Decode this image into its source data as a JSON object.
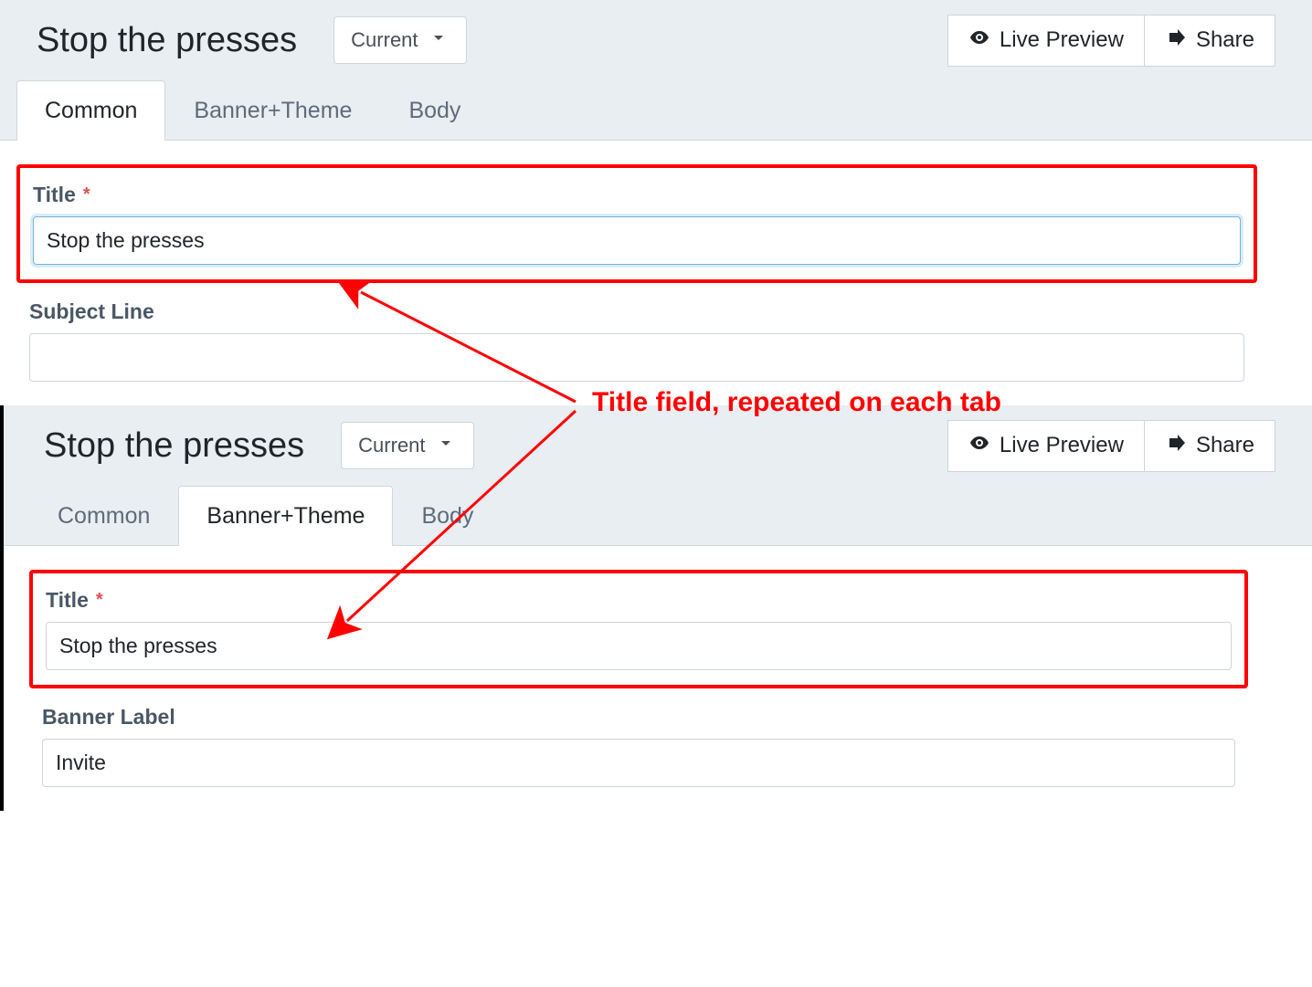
{
  "annotation": {
    "callout_text": "Title field, repeated on each tab"
  },
  "panel1": {
    "page_title": "Stop the presses",
    "version_button": "Current",
    "live_preview": "Live Preview",
    "share": "Share",
    "tabs": {
      "common": "Common",
      "banner": "Banner+Theme",
      "body": "Body"
    },
    "fields": {
      "title_label": "Title",
      "title_value": "Stop the presses",
      "subject_label": "Subject Line",
      "subject_value": ""
    }
  },
  "panel2": {
    "page_title": "Stop the presses",
    "version_button": "Current",
    "live_preview": "Live Preview",
    "share": "Share",
    "tabs": {
      "common": "Common",
      "banner": "Banner+Theme",
      "body": "Body"
    },
    "fields": {
      "title_label": "Title",
      "title_value": "Stop the presses",
      "banner_label": "Banner Label",
      "banner_value": "Invite"
    }
  },
  "required_mark": "*"
}
